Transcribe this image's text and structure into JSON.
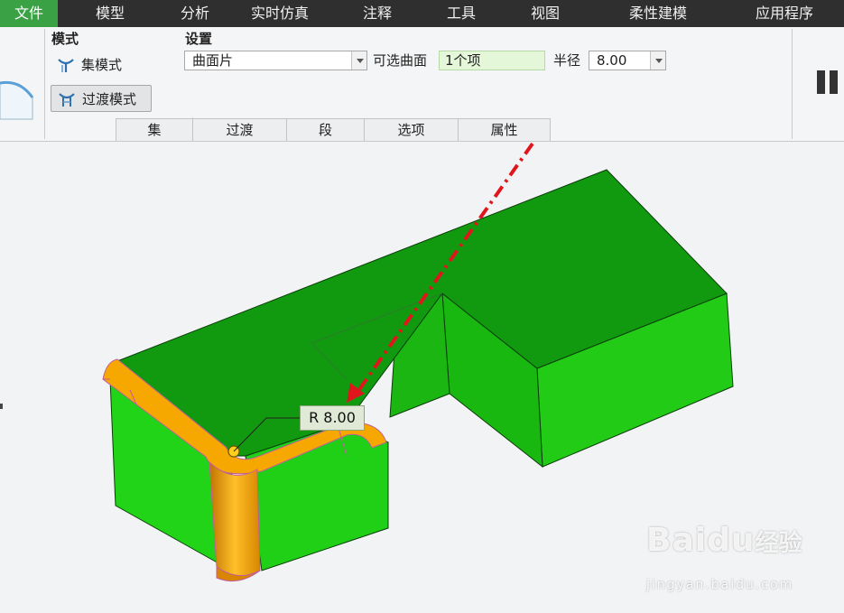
{
  "menu": {
    "items": [
      {
        "label": "文件",
        "active": true
      },
      {
        "label": "模型"
      },
      {
        "label": "分析"
      },
      {
        "label": "实时仿真"
      },
      {
        "label": "注释"
      },
      {
        "label": "工具"
      },
      {
        "label": "视图"
      },
      {
        "label": "柔性建模"
      },
      {
        "label": "应用程序"
      }
    ]
  },
  "ribbon": {
    "mode_group": {
      "title": "模式",
      "set_mode": "集模式",
      "transition_mode": "过渡模式"
    },
    "settings_group": {
      "title": "设置",
      "type_value": "曲面片",
      "optional_surface_label": "可选曲面",
      "optional_surface_value": "1个项",
      "radius_label": "半径",
      "radius_value": "8.00"
    },
    "tabs": [
      "集",
      "过渡",
      "段",
      "选项",
      "属性"
    ]
  },
  "canvas": {
    "radius_tag": "R 8.00",
    "watermark_brand": "Bai",
    "watermark_brand2": "du",
    "watermark_cn": "经验",
    "watermark_url": "jingyan.baidu.com"
  },
  "colors": {
    "menubar": "#2f2f2f",
    "active_menu": "#3aa245",
    "model_green": "#19c219",
    "fillet_orange": "#f5a300",
    "annotation_red": "#e0161c"
  }
}
